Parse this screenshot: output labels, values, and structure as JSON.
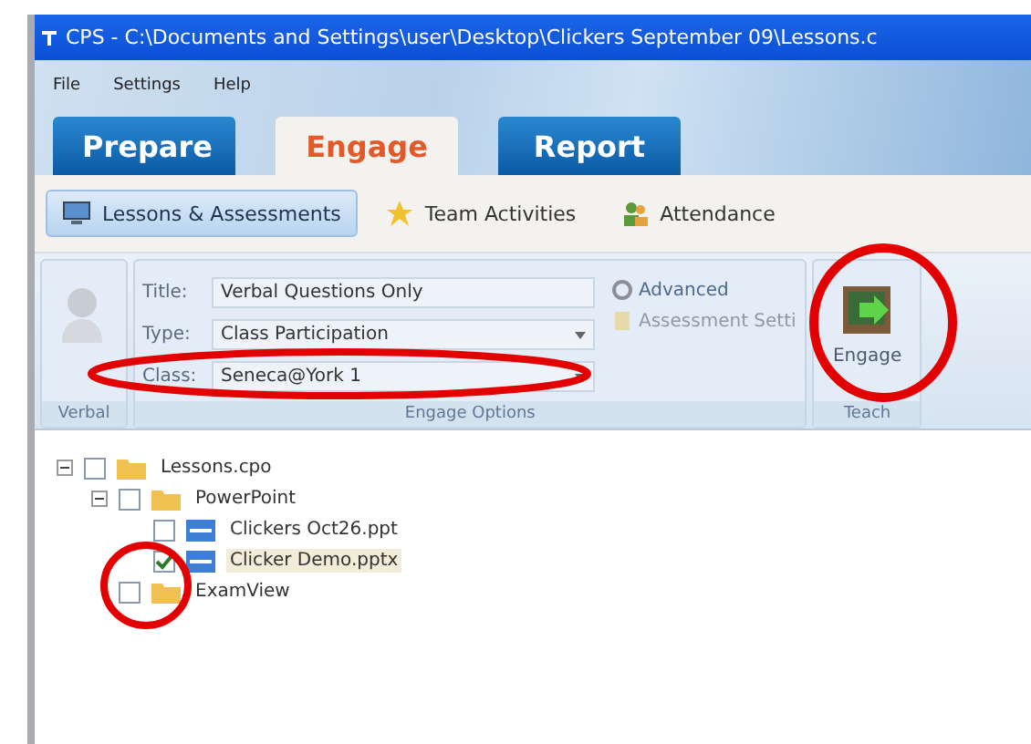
{
  "window": {
    "title": "CPS - C:\\Documents and Settings\\user\\Desktop\\Clickers September 09\\Lessons.c"
  },
  "menu": [
    "File",
    "Settings",
    "Help"
  ],
  "tabs": [
    {
      "label": "Prepare",
      "selected": false
    },
    {
      "label": "Engage",
      "selected": true
    },
    {
      "label": "Report",
      "selected": false
    }
  ],
  "subtabs": [
    {
      "label": "Lessons & Assessments",
      "selected": true,
      "kind": "lessons"
    },
    {
      "label": "Team Activities",
      "selected": false,
      "kind": "team"
    },
    {
      "label": "Attendance",
      "selected": false,
      "kind": "attendance"
    }
  ],
  "ribbon": {
    "groups": [
      "Verbal",
      "Engage Options",
      "Teach"
    ],
    "fields": [
      {
        "label": "Title:",
        "value": "Verbal Questions Only",
        "dropdown": false
      },
      {
        "label": "Type:",
        "value": "Class Participation",
        "dropdown": true
      },
      {
        "label": "Class:",
        "value": "Seneca@York 1",
        "dropdown": true
      }
    ],
    "options": [
      {
        "label": "Advanced",
        "disabled": false
      },
      {
        "label": "Assessment Setti",
        "disabled": true
      }
    ],
    "engage_button": "Engage"
  },
  "tree": [
    {
      "label": "Lessons.cpo",
      "kind": "folder",
      "checked": false,
      "selected": false,
      "expanded": true,
      "children": [
        {
          "label": "PowerPoint",
          "kind": "folder",
          "checked": false,
          "selected": false,
          "expanded": true,
          "children": [
            {
              "label": "Clickers Oct26.ppt",
              "kind": "file",
              "checked": false,
              "selected": false
            },
            {
              "label": "Clicker Demo.pptx",
              "kind": "file",
              "checked": true,
              "selected": true
            }
          ]
        },
        {
          "label": "ExamView",
          "kind": "folder",
          "checked": false,
          "selected": false
        }
      ]
    }
  ]
}
